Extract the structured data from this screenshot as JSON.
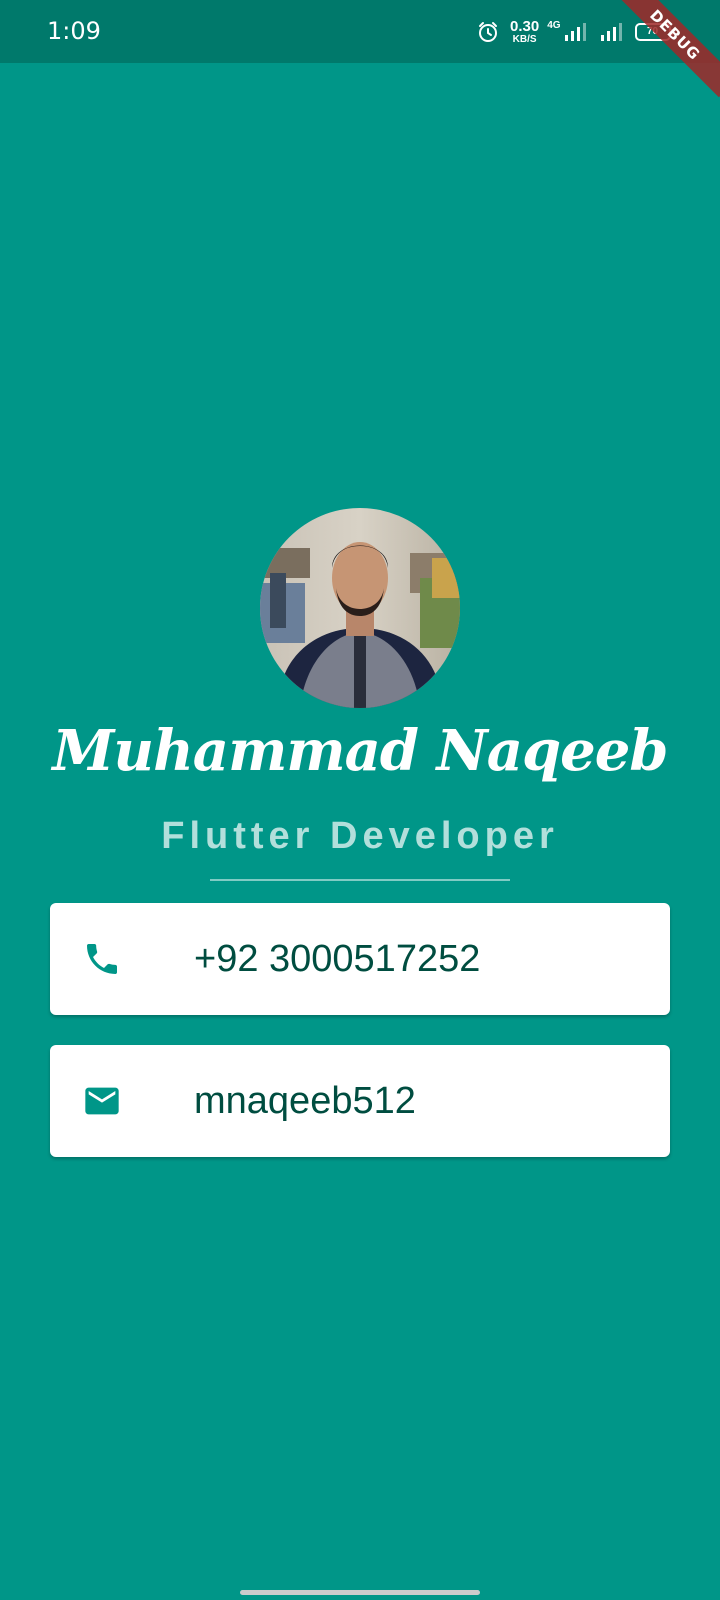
{
  "status_bar": {
    "time": "1:09",
    "net_speed_value": "0.30",
    "net_speed_unit": "KB/S",
    "network_type": "4G",
    "battery": "70",
    "alarm_icon": "alarm-icon",
    "signal_icon": "signal-icon",
    "battery_icon": "battery-icon"
  },
  "debug_banner": "DEBUG",
  "profile": {
    "name": "Muhammad Naqeeb",
    "title": "Flutter Developer",
    "avatar_icon": "profile-photo"
  },
  "contacts": [
    {
      "icon": "phone-icon",
      "value": "+92 3000517252"
    },
    {
      "icon": "email-icon",
      "value": "mnaqeeb512"
    }
  ],
  "colors": {
    "background": "#009688",
    "status_bar": "#00796B",
    "card": "#ffffff",
    "card_text": "#004D40",
    "icon": "#009688",
    "subtitle": "#B2DFDB"
  }
}
